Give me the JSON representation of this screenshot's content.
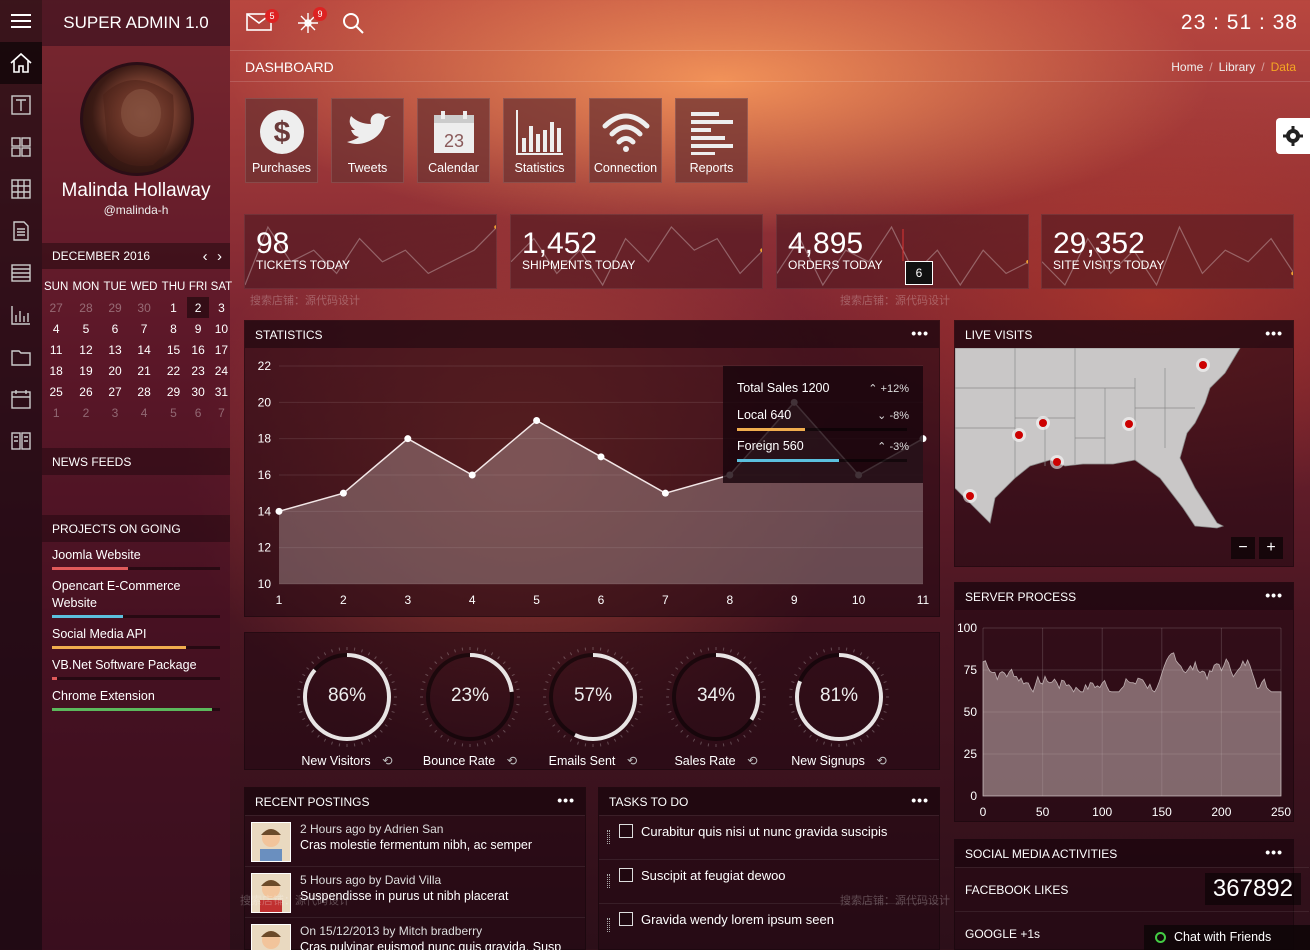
{
  "app": {
    "title": "SUPER ADMIN 1.0",
    "clock": "23 : 51 : 38"
  },
  "topbar": {
    "mail_badge": "5",
    "network_badge": "9"
  },
  "user": {
    "name": "Malinda Hollaway",
    "handle": "@malinda-h"
  },
  "calendar": {
    "month": "DECEMBER 2016",
    "days": [
      "SUN",
      "MON",
      "TUE",
      "WED",
      "THU",
      "FRI",
      "SAT"
    ],
    "weeks": [
      [
        "27",
        "28",
        "29",
        "30",
        "1",
        "2",
        "3"
      ],
      [
        "4",
        "5",
        "6",
        "7",
        "8",
        "9",
        "10"
      ],
      [
        "11",
        "12",
        "13",
        "14",
        "15",
        "16",
        "17"
      ],
      [
        "18",
        "19",
        "20",
        "21",
        "22",
        "23",
        "24"
      ],
      [
        "25",
        "26",
        "27",
        "28",
        "29",
        "30",
        "31"
      ],
      [
        "1",
        "2",
        "3",
        "4",
        "5",
        "6",
        "7"
      ]
    ],
    "selected": "2"
  },
  "news_feeds": {
    "title": "NEWS FEEDS"
  },
  "projects": {
    "title": "PROJECTS ON GOING",
    "items": [
      {
        "label": "Joomla Website",
        "progress": 0.45,
        "color": "#e05a5a"
      },
      {
        "label": "Opencart E-Commerce Website",
        "progress": 0.42,
        "color": "#5bc0de"
      },
      {
        "label": "Social Media API",
        "progress": 0.8,
        "color": "#f0ad4e"
      },
      {
        "label": "VB.Net Software Package",
        "progress": 0.03,
        "color": "#e05a5a"
      },
      {
        "label": "Chrome Extension",
        "progress": 0.95,
        "color": "#5cb85c"
      }
    ]
  },
  "header": {
    "title": "DASHBOARD",
    "breadcrumb": [
      "Home",
      "Library",
      "Data"
    ]
  },
  "tiles": [
    {
      "label": "Purchases",
      "icon": "dollar-icon"
    },
    {
      "label": "Tweets",
      "icon": "twitter-bird-icon"
    },
    {
      "label": "Calendar",
      "icon": "calendar-icon"
    },
    {
      "label": "Statistics",
      "icon": "bar-chart-icon"
    },
    {
      "label": "Connection",
      "icon": "wifi-icon"
    },
    {
      "label": "Reports",
      "icon": "list-icon"
    }
  ],
  "stats": [
    {
      "value": "98",
      "label": "TICKETS TODAY",
      "spark": [
        3,
        8,
        5,
        6,
        4,
        7,
        5,
        6,
        4,
        5,
        6,
        8
      ]
    },
    {
      "value": "1,452",
      "label": "SHIPMENTS TODAY",
      "spark": [
        4,
        6,
        3,
        5,
        2,
        6,
        4,
        7,
        5,
        6,
        3,
        5
      ]
    },
    {
      "value": "4,895",
      "label": "ORDERS TODAY",
      "spark": [
        4,
        7,
        3,
        6,
        5,
        8,
        4,
        6,
        3,
        6,
        4,
        5
      ],
      "tooltip": "6"
    },
    {
      "value": "29,352",
      "label": "SITE VISITS TODAY",
      "spark": [
        5,
        3,
        7,
        4,
        6,
        3,
        8,
        4,
        6,
        5,
        7,
        4
      ]
    }
  ],
  "statistics": {
    "title": "STATISTICS",
    "legend": [
      {
        "label": "Total Sales 1200",
        "change": "+12%",
        "color": ""
      },
      {
        "label": "Local 640",
        "change": "-8%",
        "color": "#f0ad4e"
      },
      {
        "label": "Foreign 560",
        "change": "-3%",
        "color": "#5bc0de"
      }
    ]
  },
  "chart_data": [
    {
      "type": "area",
      "title": "STATISTICS",
      "x": [
        1,
        2,
        3,
        4,
        5,
        6,
        7,
        8,
        9,
        10,
        11
      ],
      "values": [
        14,
        15,
        18,
        16,
        19,
        17,
        15,
        16,
        20,
        16,
        18
      ],
      "ylim": [
        10,
        22
      ],
      "yticks": [
        10,
        12,
        14,
        16,
        18,
        20,
        22
      ]
    },
    {
      "type": "area",
      "title": "SERVER PROCESS",
      "xlim": [
        0,
        250
      ],
      "ylim": [
        0,
        100
      ],
      "xticks": [
        0,
        50,
        100,
        150,
        200,
        250
      ],
      "yticks": [
        0,
        25,
        50,
        75,
        100
      ],
      "series_desc": "noisy values between ~60 and ~90"
    }
  ],
  "live_visits": {
    "title": "LIVE VISITS",
    "zoom_out": "−",
    "zoom_in": "+"
  },
  "server_process": {
    "title": "SERVER PROCESS"
  },
  "gauges": [
    {
      "value": "86%",
      "fraction": 0.86,
      "label": "New Visitors"
    },
    {
      "value": "23%",
      "fraction": 0.23,
      "label": "Bounce Rate"
    },
    {
      "value": "57%",
      "fraction": 0.57,
      "label": "Emails Sent"
    },
    {
      "value": "34%",
      "fraction": 0.34,
      "label": "Sales Rate"
    },
    {
      "value": "81%",
      "fraction": 0.81,
      "label": "New Signups"
    }
  ],
  "postings": {
    "title": "RECENT POSTINGS",
    "items": [
      {
        "meta": "2 Hours ago by Adrien San",
        "text": "Cras molestie fermentum nibh, ac semper"
      },
      {
        "meta": "5 Hours ago by David Villa",
        "text": "Suspendisse in purus ut nibh placerat"
      },
      {
        "meta": "On 15/12/2013 by Mitch bradberry",
        "text": "Cras pulvinar euismod nunc quis gravida. Susp"
      }
    ]
  },
  "tasks": {
    "title": "TASKS TO DO",
    "items": [
      "Curabitur quis nisi ut nunc gravida suscipis",
      "Suscipit at feugiat dewoo",
      "Gravida wendy lorem ipsum seen"
    ]
  },
  "social": {
    "title": "SOCIAL MEDIA ACTIVITIES",
    "items": [
      {
        "label": "FACEBOOK LIKES",
        "value": "367892"
      },
      {
        "label": "GOOGLE +1s",
        "value": ""
      }
    ]
  },
  "chat": {
    "label": "Chat with Friends"
  },
  "watermark": "搜索店铺：源代码设计"
}
